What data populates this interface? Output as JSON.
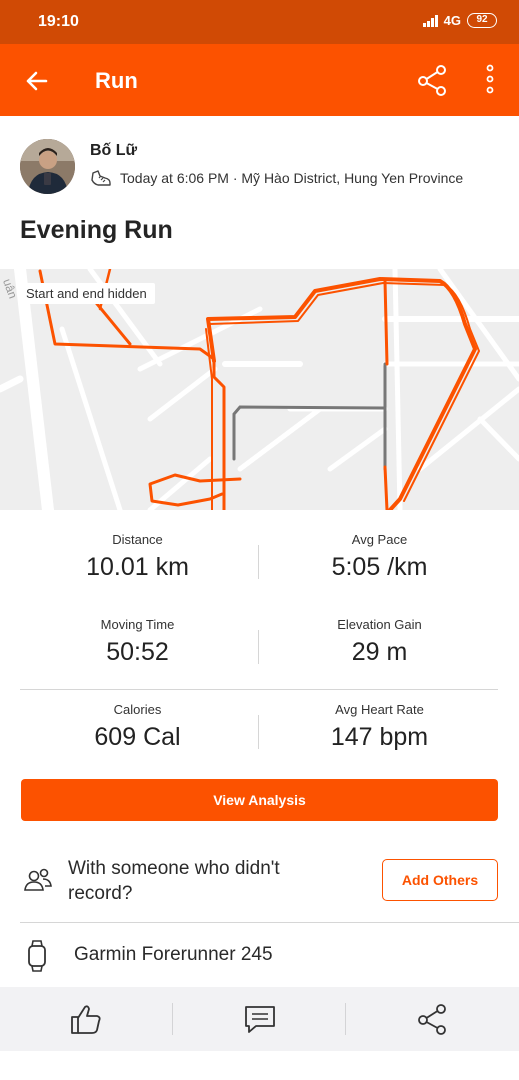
{
  "status_bar": {
    "time": "19:10",
    "network": "4G",
    "battery": "92"
  },
  "header": {
    "title": "Run",
    "back_icon": "arrow-left-icon",
    "share_icon": "share-icon",
    "more_icon": "more-vertical-icon"
  },
  "athlete": {
    "name": "Bố Lữ",
    "meta": "Today at 6:06 PM · Mỹ Hào District, Hung Yen Province"
  },
  "activity": {
    "title": "Evening Run"
  },
  "map": {
    "badge": "Start and end hidden",
    "route_color": "#fc5200"
  },
  "stats": [
    {
      "label": "Distance",
      "value": "10.01 km"
    },
    {
      "label": "Avg Pace",
      "value": "5:05 /km"
    },
    {
      "label": "Moving Time",
      "value": "50:52"
    },
    {
      "label": "Elevation Gain",
      "value": "29 m"
    },
    {
      "label": "Calories",
      "value": "609 Cal"
    },
    {
      "label": "Avg Heart Rate",
      "value": "147 bpm"
    }
  ],
  "actions": {
    "view_analysis": "View Analysis",
    "together_prompt": "With someone who didn't record?",
    "add_others": "Add Others",
    "device": "Garmin Forerunner 245"
  },
  "bottom_bar": {
    "kudos_icon": "thumbs-up-icon",
    "comment_icon": "comment-icon",
    "share_icon": "share-icon"
  },
  "colors": {
    "brand": "#fc5200",
    "status_bar": "#d04a05"
  }
}
